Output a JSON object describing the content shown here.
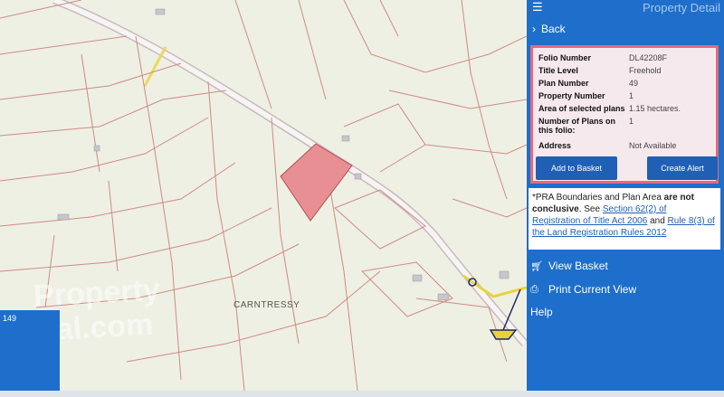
{
  "map": {
    "townland_label": "CARNTRESSY",
    "scale_text": "149",
    "watermark": [
      "Property",
      "Pal.com"
    ]
  },
  "panel": {
    "title": "Property Detail",
    "back_label": "Back",
    "details": {
      "folio_label": "Folio Number",
      "folio_value": "DL42208F",
      "title_label": "Title Level",
      "title_value": "Freehold",
      "plan_label": "Plan Number",
      "plan_value": "49",
      "property_label": "Property Number",
      "property_value": "1",
      "area_label": "Area of selected plans",
      "area_value": "1.15 hectares.",
      "numplans_label": "Number of Plans on this folio:",
      "numplans_value": "1",
      "address_label": "Address",
      "address_value": "Not Available"
    },
    "add_basket_label": "Add to Basket",
    "create_alert_label": "Create Alert",
    "note": {
      "pre": "*PRA Boundaries and Plan Area ",
      "bold": "are not conclusive",
      "mid1": ". See ",
      "link1": "Section 62(2) of Registration of Title Act 2006",
      "mid2": " and ",
      "link2": "Rule 8(3) of the Land Registration Rules 2012"
    },
    "view_basket_label": "View Basket",
    "print_label": "Print Current View",
    "help_label": "Help"
  },
  "colors": {
    "panel_blue": "#1d6fcb",
    "highlight_border": "#e46a7c",
    "plot_fill": "#e88f93",
    "boundary": "#c9827a"
  }
}
